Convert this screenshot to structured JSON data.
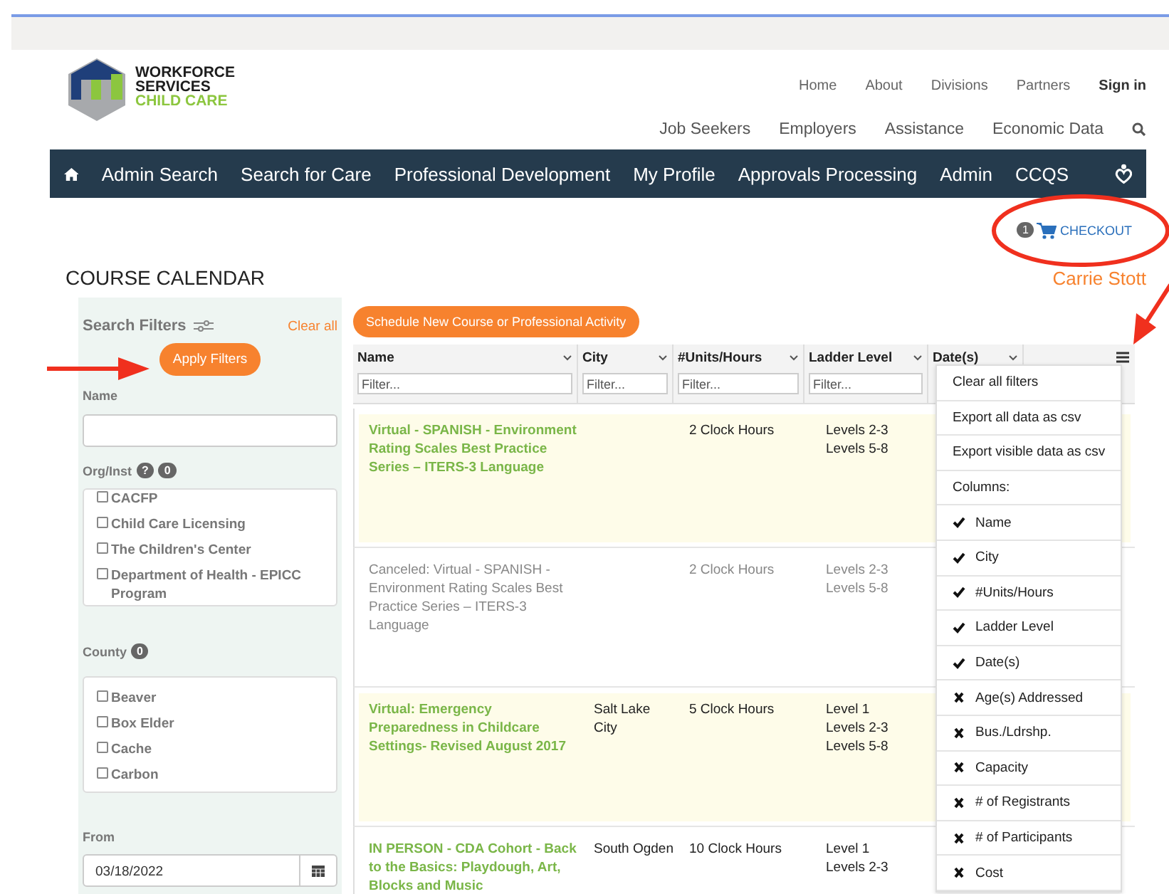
{
  "header": {
    "logo": {
      "line1": "WORKFORCE",
      "line2": "SERVICES",
      "line3": "CHILD CARE"
    },
    "top_links": [
      "Home",
      "About",
      "Divisions",
      "Partners"
    ],
    "sign_in": "Sign in",
    "secondary_links": [
      "Job Seekers",
      "Employers",
      "Assistance",
      "Economic Data"
    ]
  },
  "nav": {
    "items": [
      "Admin Search",
      "Search for Care",
      "Professional Development",
      "My Profile",
      "Approvals Processing",
      "Admin",
      "CCQS"
    ]
  },
  "cart": {
    "count": "1",
    "label": "CHECKOUT"
  },
  "page_title": "COURSE CALENDAR",
  "user_name": "Carrie Stott",
  "filters": {
    "title": "Search Filters",
    "clear": "Clear all",
    "apply": "Apply Filters",
    "name_label": "Name",
    "org": {
      "label": "Org/Inst",
      "help": "?",
      "count": "0",
      "options": [
        {
          "label": "CACFP",
          "checked": false
        },
        {
          "label": "Child Care Licensing",
          "checked": false
        },
        {
          "label": "The Children's Center",
          "checked": false
        },
        {
          "label": "Department of Health - EPICC Program",
          "checked": false
        }
      ]
    },
    "county": {
      "label": "County",
      "count": "0",
      "options": [
        {
          "label": "Beaver",
          "checked": false
        },
        {
          "label": "Box Elder",
          "checked": false
        },
        {
          "label": "Cache",
          "checked": false
        },
        {
          "label": "Carbon",
          "checked": false
        }
      ]
    },
    "from": {
      "label": "From",
      "value": "03/18/2022"
    }
  },
  "schedule_button": "Schedule New Course or Professional Activity",
  "table": {
    "columns": [
      {
        "label": "Name",
        "placeholder": "Filter..."
      },
      {
        "label": "City",
        "placeholder": "Filter..."
      },
      {
        "label": "#Units/Hours",
        "placeholder": "Filter..."
      },
      {
        "label": "Ladder Level",
        "placeholder": "Filter..."
      },
      {
        "label": "Date(s)"
      }
    ],
    "rows": [
      {
        "name": "Virtual - SPANISH - Environment Rating Scales Best Practice Series – ITERS-3 Language",
        "city": "",
        "units": "2 Clock Hours",
        "levels": [
          "Levels 2-3",
          "Levels 5-8"
        ],
        "highlighted": true,
        "canceled": false
      },
      {
        "name": "Canceled: Virtual - SPANISH - Environment Rating Scales Best Practice Series – ITERS-3 Language",
        "city": "",
        "units": "2 Clock Hours",
        "levels": [
          "Levels 2-3",
          "Levels 5-8"
        ],
        "highlighted": false,
        "canceled": true
      },
      {
        "name": "Virtual: Emergency Preparedness in Childcare Settings- Revised August 2017",
        "city": "Salt Lake City",
        "units": "5 Clock Hours",
        "levels": [
          "Level 1",
          "Levels 2-3",
          "Levels 5-8"
        ],
        "highlighted": true,
        "canceled": false
      },
      {
        "name": "IN PERSON - CDA Cohort - Back to the Basics: Playdough, Art, Blocks and Music",
        "city": "South Ogden",
        "units": "10 Clock Hours",
        "levels": [
          "Level 1",
          "Levels 2-3"
        ],
        "highlighted": false,
        "canceled": false
      }
    ]
  },
  "column_menu": {
    "actions": [
      "Clear all filters",
      "Export all data as csv",
      "Export visible data as csv"
    ],
    "columns_label": "Columns:",
    "columns": [
      {
        "label": "Name",
        "visible": true
      },
      {
        "label": "City",
        "visible": true
      },
      {
        "label": "#Units/Hours",
        "visible": true
      },
      {
        "label": "Ladder Level",
        "visible": true
      },
      {
        "label": "Date(s)",
        "visible": true
      },
      {
        "label": "Age(s) Addressed",
        "visible": false
      },
      {
        "label": "Bus./Ldrshp.",
        "visible": false
      },
      {
        "label": "Capacity",
        "visible": false
      },
      {
        "label": "# of Registrants",
        "visible": false
      },
      {
        "label": "# of Participants",
        "visible": false
      },
      {
        "label": "Cost",
        "visible": false
      }
    ]
  }
}
